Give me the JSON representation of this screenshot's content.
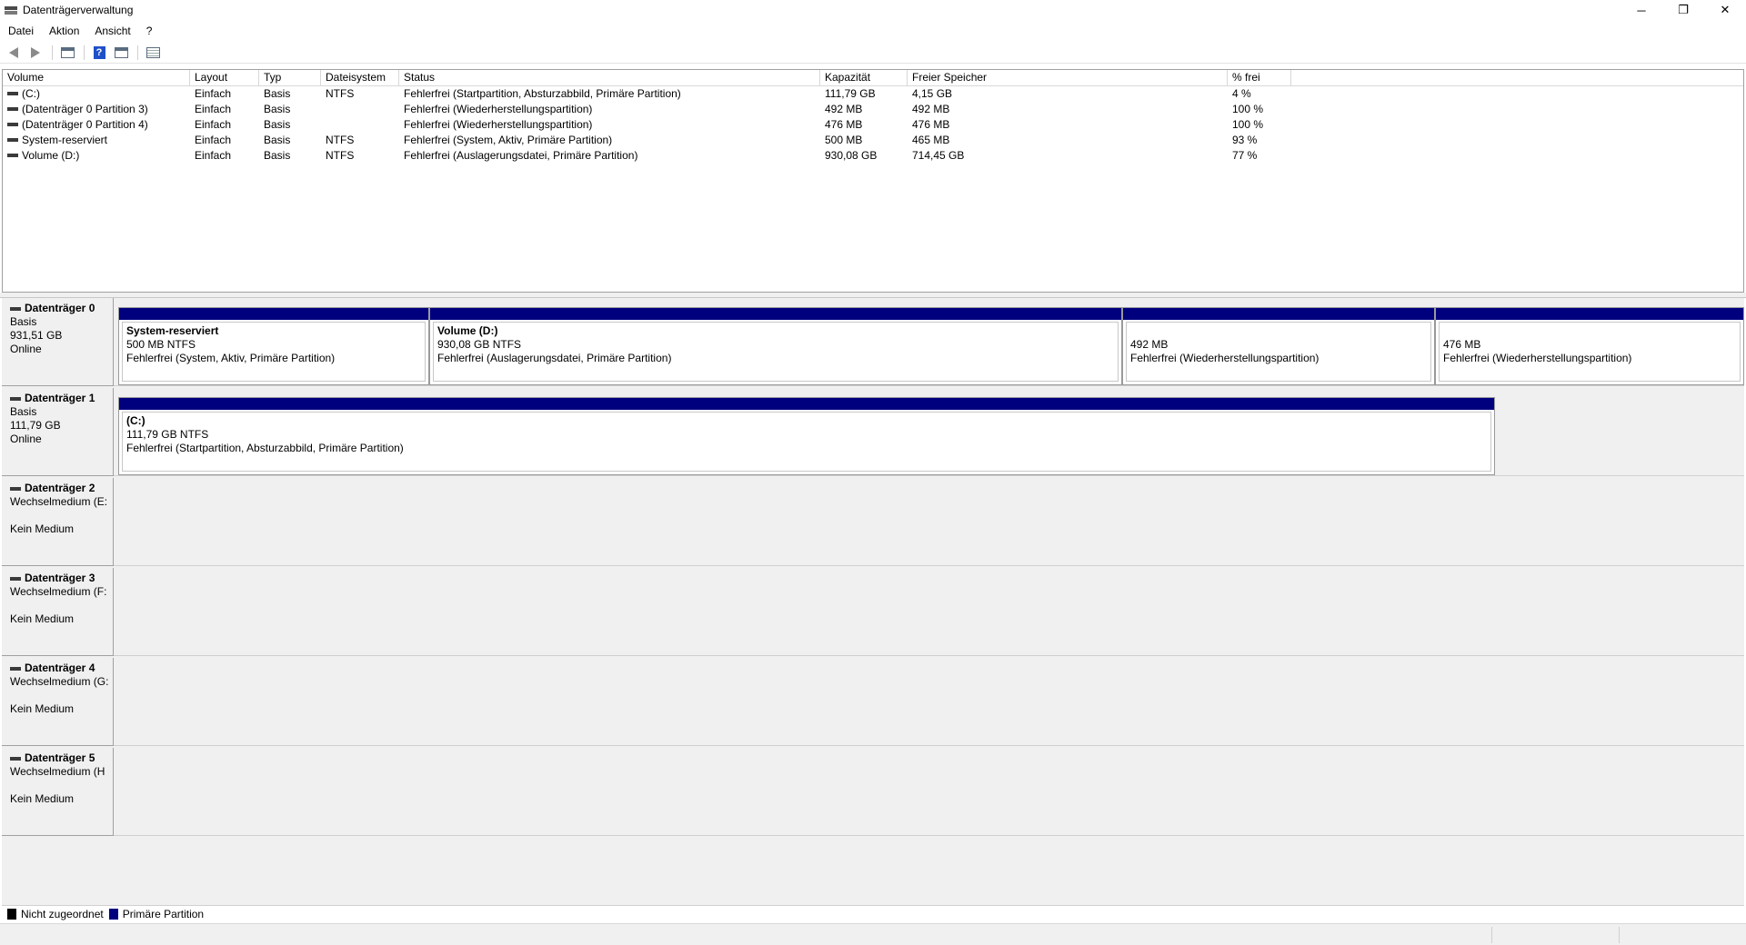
{
  "window": {
    "title": "Datenträgerverwaltung",
    "icon": "disk-management-icon",
    "controls": [
      "─",
      "❐",
      "✕"
    ]
  },
  "menu": [
    "Datei",
    "Aktion",
    "Ansicht",
    "?"
  ],
  "toolbar": [
    "back-icon",
    "forward-icon",
    "console-tree-icon",
    "help-icon",
    "properties-icon",
    "list-view-icon"
  ],
  "volumes": {
    "columns": [
      "Volume",
      "Layout",
      "Typ",
      "Dateisystem",
      "Status",
      "Kapazität",
      "Freier Speicher",
      "% frei"
    ],
    "rows": [
      [
        "(C:)",
        "Einfach",
        "Basis",
        "NTFS",
        "Fehlerfrei (Startpartition, Absturzabbild, Primäre Partition)",
        "111,79 GB",
        "4,15 GB",
        "4 %"
      ],
      [
        "(Datenträger 0 Partition 3)",
        "Einfach",
        "Basis",
        "",
        "Fehlerfrei (Wiederherstellungspartition)",
        "492 MB",
        "492 MB",
        "100 %"
      ],
      [
        "(Datenträger 0 Partition 4)",
        "Einfach",
        "Basis",
        "",
        "Fehlerfrei (Wiederherstellungspartition)",
        "476 MB",
        "476 MB",
        "100 %"
      ],
      [
        "System-reserviert",
        "Einfach",
        "Basis",
        "NTFS",
        "Fehlerfrei (System, Aktiv, Primäre Partition)",
        "500 MB",
        "465 MB",
        "93 %"
      ],
      [
        "Volume (D:)",
        "Einfach",
        "Basis",
        "NTFS",
        "Fehlerfrei (Auslagerungsdatei, Primäre Partition)",
        "930,08 GB",
        "714,45 GB",
        "77 %"
      ]
    ]
  },
  "disks": [
    {
      "name": "Datenträger 0",
      "line1": "Basis",
      "line2": "931,51 GB",
      "line3": "Online",
      "partitions": [
        {
          "name": "System-reserviert",
          "size": "500 MB NTFS",
          "status": "Fehlerfrei (System, Aktiv, Primäre Partition)"
        },
        {
          "name": "Volume  (D:)",
          "size": "930,08 GB NTFS",
          "status": "Fehlerfrei (Auslagerungsdatei, Primäre Partition)"
        },
        {
          "name": "",
          "size": "492 MB",
          "status": "Fehlerfrei (Wiederherstellungspartition)"
        },
        {
          "name": "",
          "size": "476 MB",
          "status": "Fehlerfrei (Wiederherstellungspartition)"
        }
      ]
    },
    {
      "name": "Datenträger 1",
      "line1": "Basis",
      "line2": "111,79 GB",
      "line3": "Online",
      "partitions": [
        {
          "name": "(C:)",
          "size": "111,79 GB NTFS",
          "status": "Fehlerfrei (Startpartition, Absturzabbild, Primäre Partition)"
        }
      ]
    },
    {
      "name": "Datenträger 2",
      "line1": "Wechselmedium (E:",
      "line2": "",
      "line3": "Kein Medium",
      "partitions": []
    },
    {
      "name": "Datenträger 3",
      "line1": "Wechselmedium (F:",
      "line2": "",
      "line3": "Kein Medium",
      "partitions": []
    },
    {
      "name": "Datenträger 4",
      "line1": "Wechselmedium (G:",
      "line2": "",
      "line3": "Kein Medium",
      "partitions": []
    },
    {
      "name": "Datenträger 5",
      "line1": "Wechselmedium (H",
      "line2": "",
      "line3": "Kein Medium",
      "partitions": []
    }
  ],
  "legend": [
    {
      "label": "Nicht zugeordnet",
      "color": "#000000"
    },
    {
      "label": "Primäre Partition",
      "color": "#00007f"
    }
  ]
}
